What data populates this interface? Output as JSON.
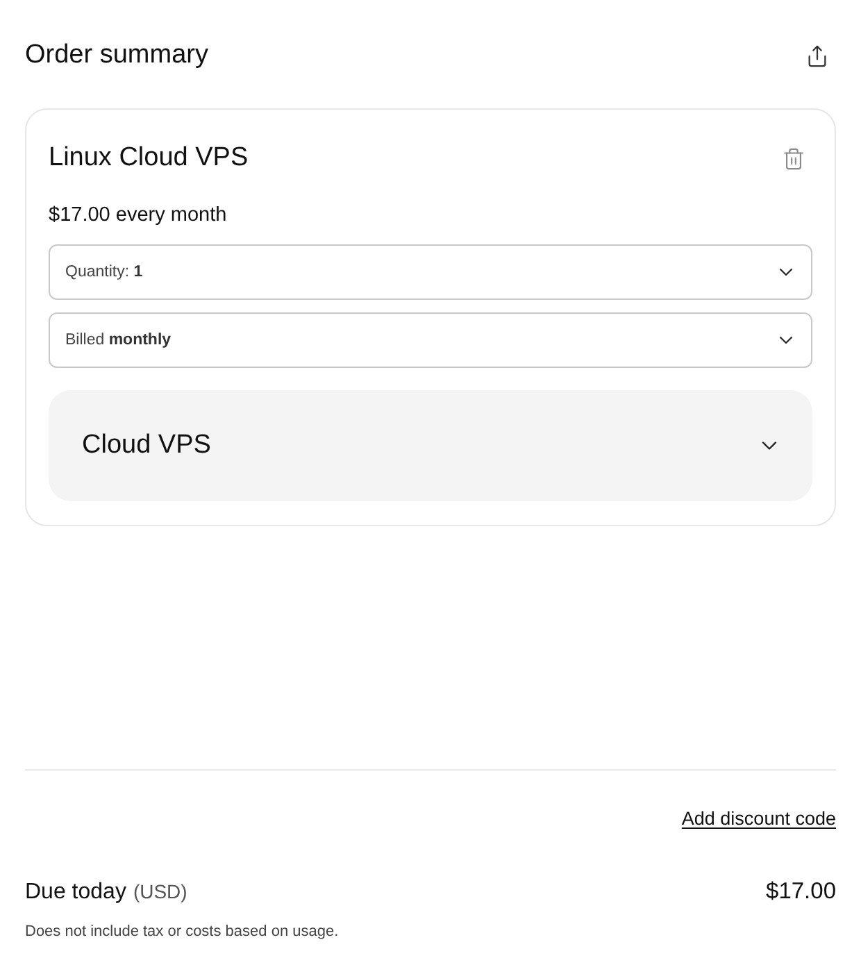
{
  "header": {
    "title": "Order summary"
  },
  "product": {
    "title": "Linux Cloud VPS",
    "price": "$17.00 every month",
    "selects": [
      {
        "text": "Quantity: **1**"
      },
      {
        "text": "Billed **monthly**"
      }
    ],
    "section": {
      "title": "Cloud VPS",
      "expanded": false
    }
  },
  "discount_link": "Add discount code",
  "total": {
    "label": "Due today",
    "currency": "(USD)",
    "amount": "$17.00",
    "note": "Does not include tax or costs based on usage."
  }
}
